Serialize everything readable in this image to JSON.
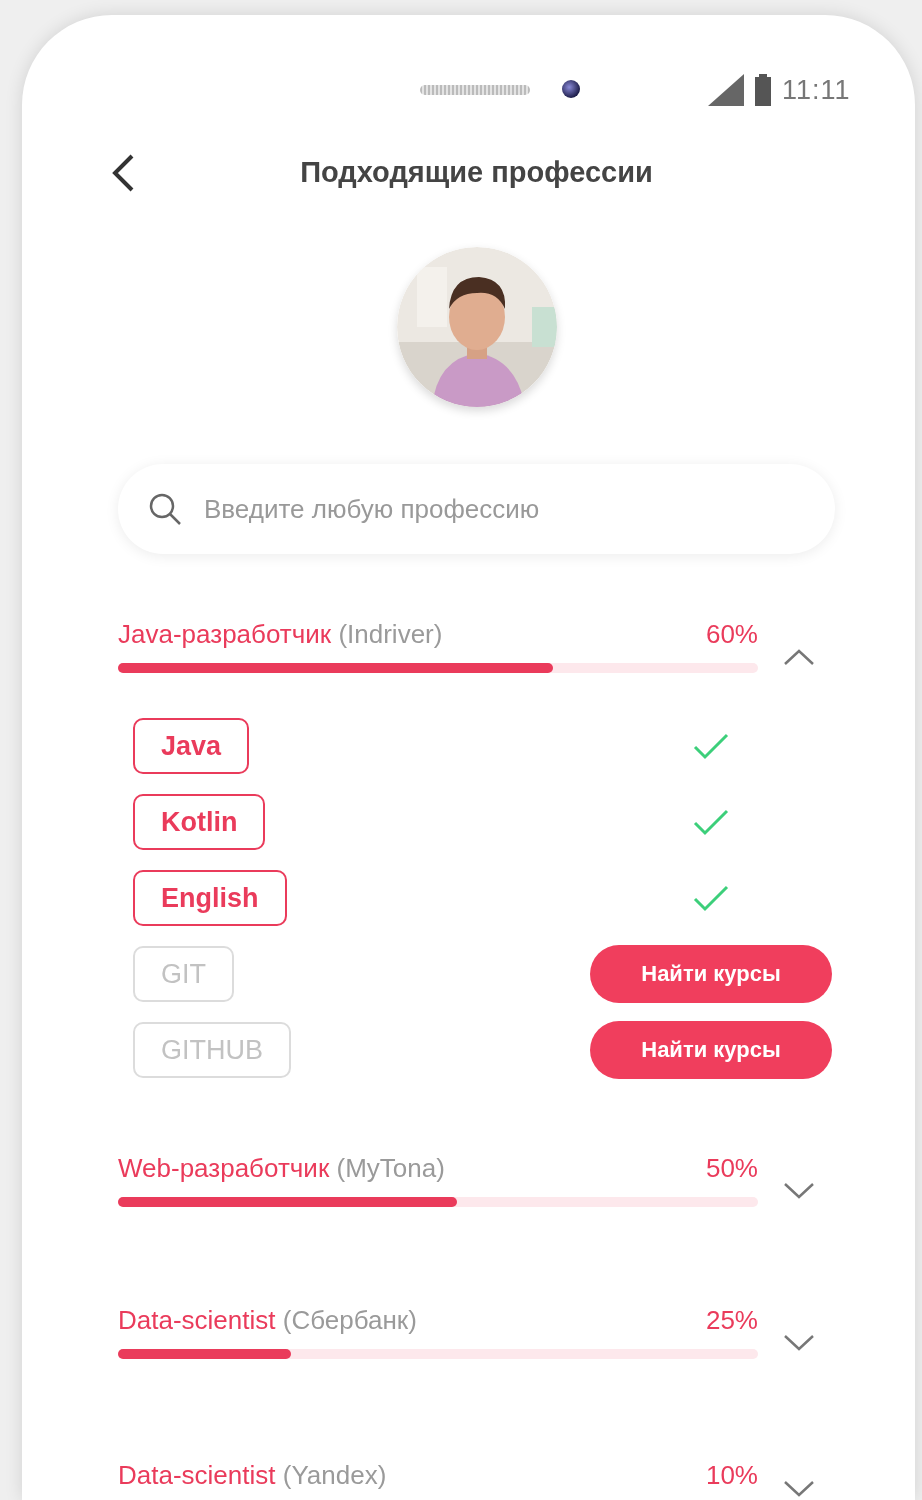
{
  "status_bar": {
    "time": "11:11"
  },
  "header": {
    "title": "Подходящие профессии"
  },
  "search": {
    "placeholder": "Введите любую профессию"
  },
  "professions": [
    {
      "name": "Java-разработчик",
      "company": "(Indriver)",
      "percent": "60%",
      "level": 0.68,
      "expanded": true,
      "skills": [
        {
          "label": "Java",
          "acquired": true
        },
        {
          "label": "Kotlin",
          "acquired": true
        },
        {
          "label": "English",
          "acquired": true
        },
        {
          "label": "GIT",
          "acquired": false,
          "action": "Найти курсы"
        },
        {
          "label": "GITHUB",
          "acquired": false,
          "action": "Найти курсы"
        }
      ]
    },
    {
      "name": "Web-разработчик",
      "company": "(MyTona)",
      "percent": "50%",
      "level": 0.53,
      "expanded": false
    },
    {
      "name": "Data-scientist",
      "company": "(Сбербанк)",
      "percent": "25%",
      "level": 0.27,
      "expanded": false
    },
    {
      "name": "Data-scientist",
      "company": "(Yandex)",
      "percent": "10%",
      "expanded": false
    }
  ]
}
